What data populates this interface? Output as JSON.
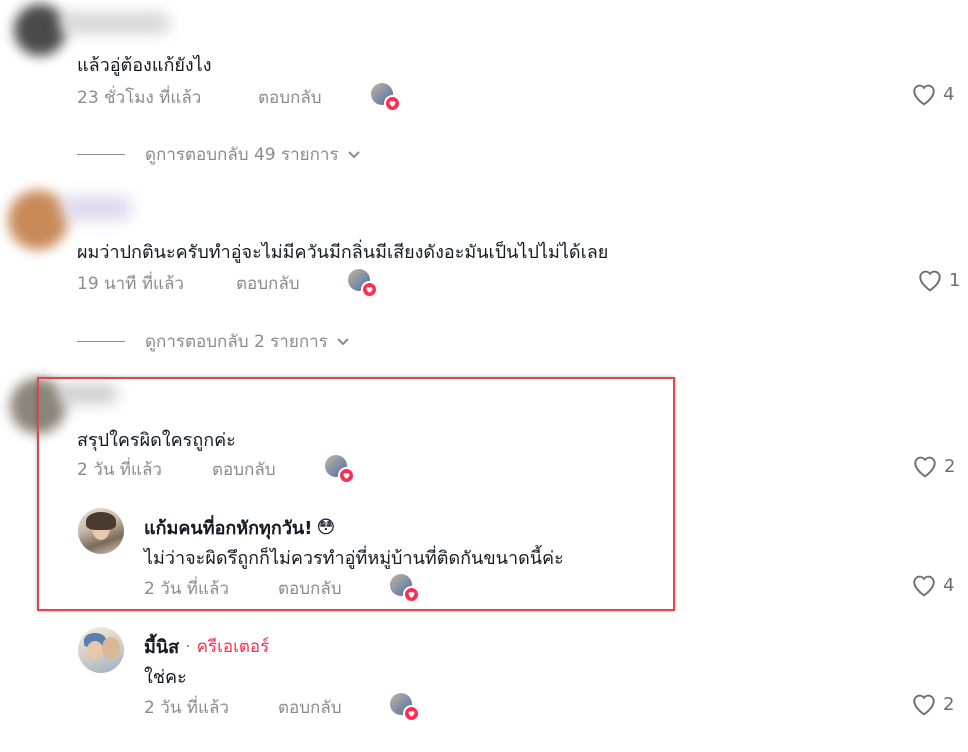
{
  "comments": [
    {
      "text": "แล้วอู่ต้องแก้ยังไง",
      "time": "23 ชั่วโมง ที่แล้ว",
      "reply_label": "ตอบกลับ",
      "likes": "4",
      "view_replies": "ดูการตอบกลับ 49 รายการ"
    },
    {
      "text": "ผมว่าปกตินะครับทำอู่จะไม่มีควันมีกลิ่นมีเสียงดังอะมันเป็นไปไม่ได้เลย",
      "time": "19 นาที ที่แล้ว",
      "reply_label": "ตอบกลับ",
      "likes": "1",
      "view_replies": "ดูการตอบกลับ 2 รายการ"
    },
    {
      "text": "สรุปใครผิดใครถูกค่ะ",
      "time": "2 วัน ที่แล้ว",
      "reply_label": "ตอบกลับ",
      "likes": "2"
    }
  ],
  "replies": [
    {
      "username": "แก้มคนที่อกหักทุกวัน!",
      "emoji": "😳",
      "text": "ไม่ว่าจะผิดรึถูกก็ไม่ควรทำอู่ที่หมู่บ้านที่ติดกันขนาดนี้ค่ะ",
      "time": "2 วัน ที่แล้ว",
      "reply_label": "ตอบกลับ",
      "likes": "4"
    },
    {
      "username": "มี้นิส",
      "separator": "·",
      "creator_label": "ครีเอเตอร์",
      "text": "ใช่คะ",
      "time": "2 วัน ที่แล้ว",
      "reply_label": "ตอบกลับ",
      "likes": "2"
    }
  ],
  "colors": {
    "highlight_border": "#e0474c",
    "creator": "#fe2c55",
    "meta": "#8a8b91"
  }
}
